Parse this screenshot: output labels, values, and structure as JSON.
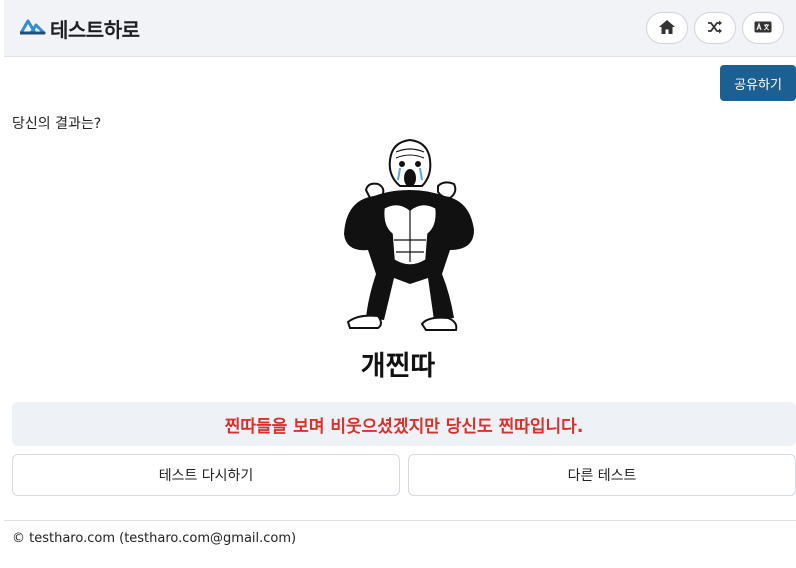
{
  "header": {
    "brand": "테스트하로",
    "logo_icon": "mountain-logo-icon",
    "buttons": [
      {
        "icon": "home-icon"
      },
      {
        "icon": "shuffle-icon"
      },
      {
        "icon": "language-icon"
      }
    ]
  },
  "share_label": "공유하기",
  "question": "당신의 결과는?",
  "result": {
    "image": "crying-gorilla-meme",
    "name": "개찐따",
    "description": "찐따들을 보며 비웃으셨겠지만 당신도 찐따입니다."
  },
  "actions": {
    "retry_label": "테스트 다시하기",
    "other_label": "다른 테스트"
  },
  "footer": "© testharo.com (testharo.com@gmail.com)",
  "colors": {
    "accent": "#1b5f93",
    "description_text": "#d9302c",
    "header_bg": "#f1f3f6"
  }
}
